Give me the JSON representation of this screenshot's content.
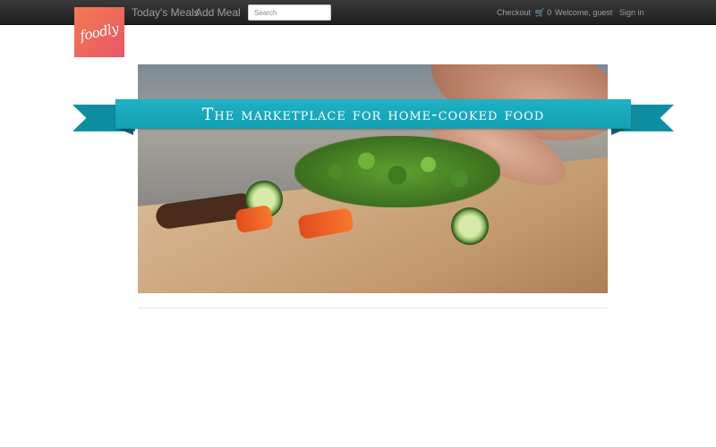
{
  "brand": {
    "logo_text": "foodly",
    "logo_gradient": [
      "#f27a4e",
      "#e9566b"
    ]
  },
  "nav": {
    "todays_meals": "Today's Meals",
    "add_meal": "Add Meal",
    "search_placeholder": "Search",
    "checkout_label": "Checkout",
    "cart_icon": "shopping-cart-icon",
    "cart_count": "0",
    "welcome": "Welcome, guest",
    "sign_in": "Sign in"
  },
  "hero": {
    "banner_text": "The marketplace for home-cooked food",
    "banner_color": "#12a0b3"
  }
}
